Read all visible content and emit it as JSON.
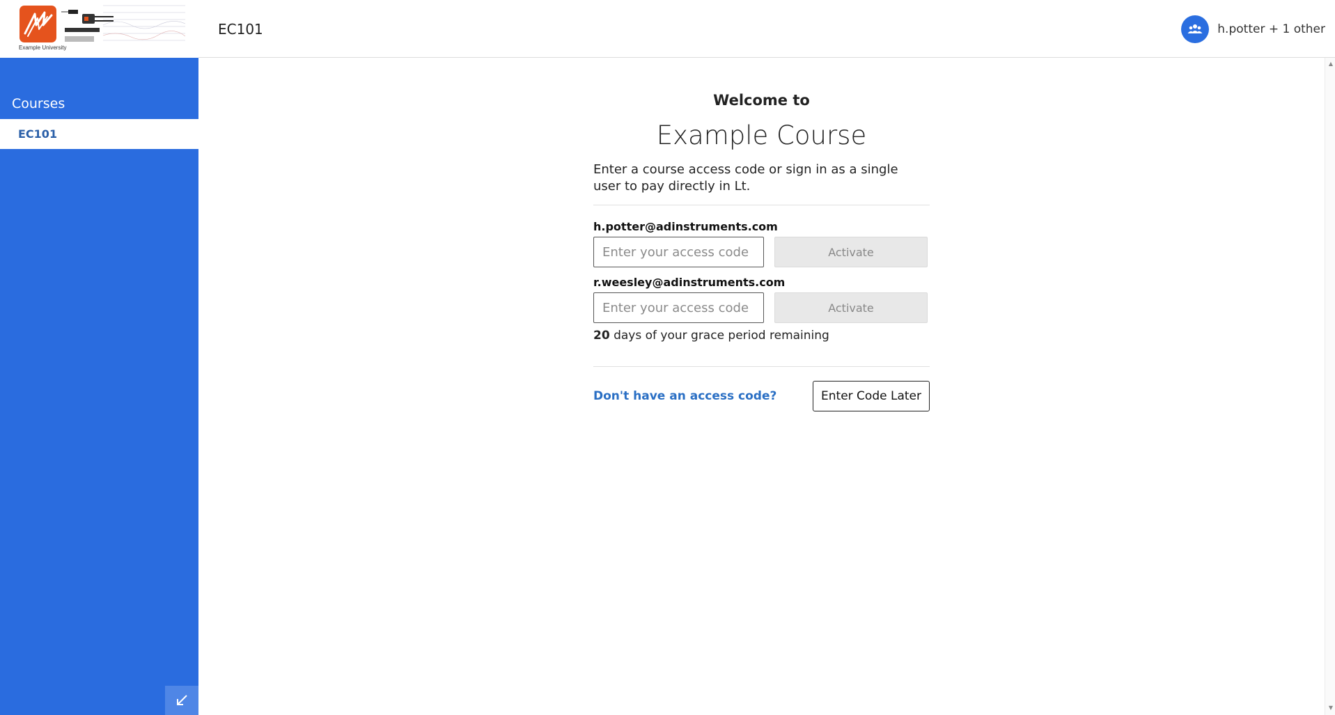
{
  "header": {
    "logo_caption": "Example University",
    "course_code": "EC101",
    "user_label": "h.potter + 1 other",
    "avatar_icon": "users-group-icon"
  },
  "sidebar": {
    "heading": "Courses",
    "items": [
      {
        "label": "EC101",
        "selected": true
      }
    ],
    "collapse_icon": "collapse-arrow-icon"
  },
  "main": {
    "welcome": "Welcome to",
    "course_name": "Example Course",
    "intro": "Enter a course access code or sign in as a single user to pay directly in Lt.",
    "users": [
      {
        "email": "h.potter@adinstruments.com",
        "placeholder": "Enter your access code",
        "value": "",
        "button": "Activate"
      },
      {
        "email": "r.weesley@adinstruments.com",
        "placeholder": "Enter your access code",
        "value": "",
        "button": "Activate"
      }
    ],
    "grace_days": "20",
    "grace_text": " days of your grace period remaining",
    "no_code_link": "Don't have an access code?",
    "later_button": "Enter Code Later"
  },
  "colors": {
    "sidebar": "#2a6cdf",
    "link": "#2a6fc4",
    "logo": "#e5531d"
  }
}
